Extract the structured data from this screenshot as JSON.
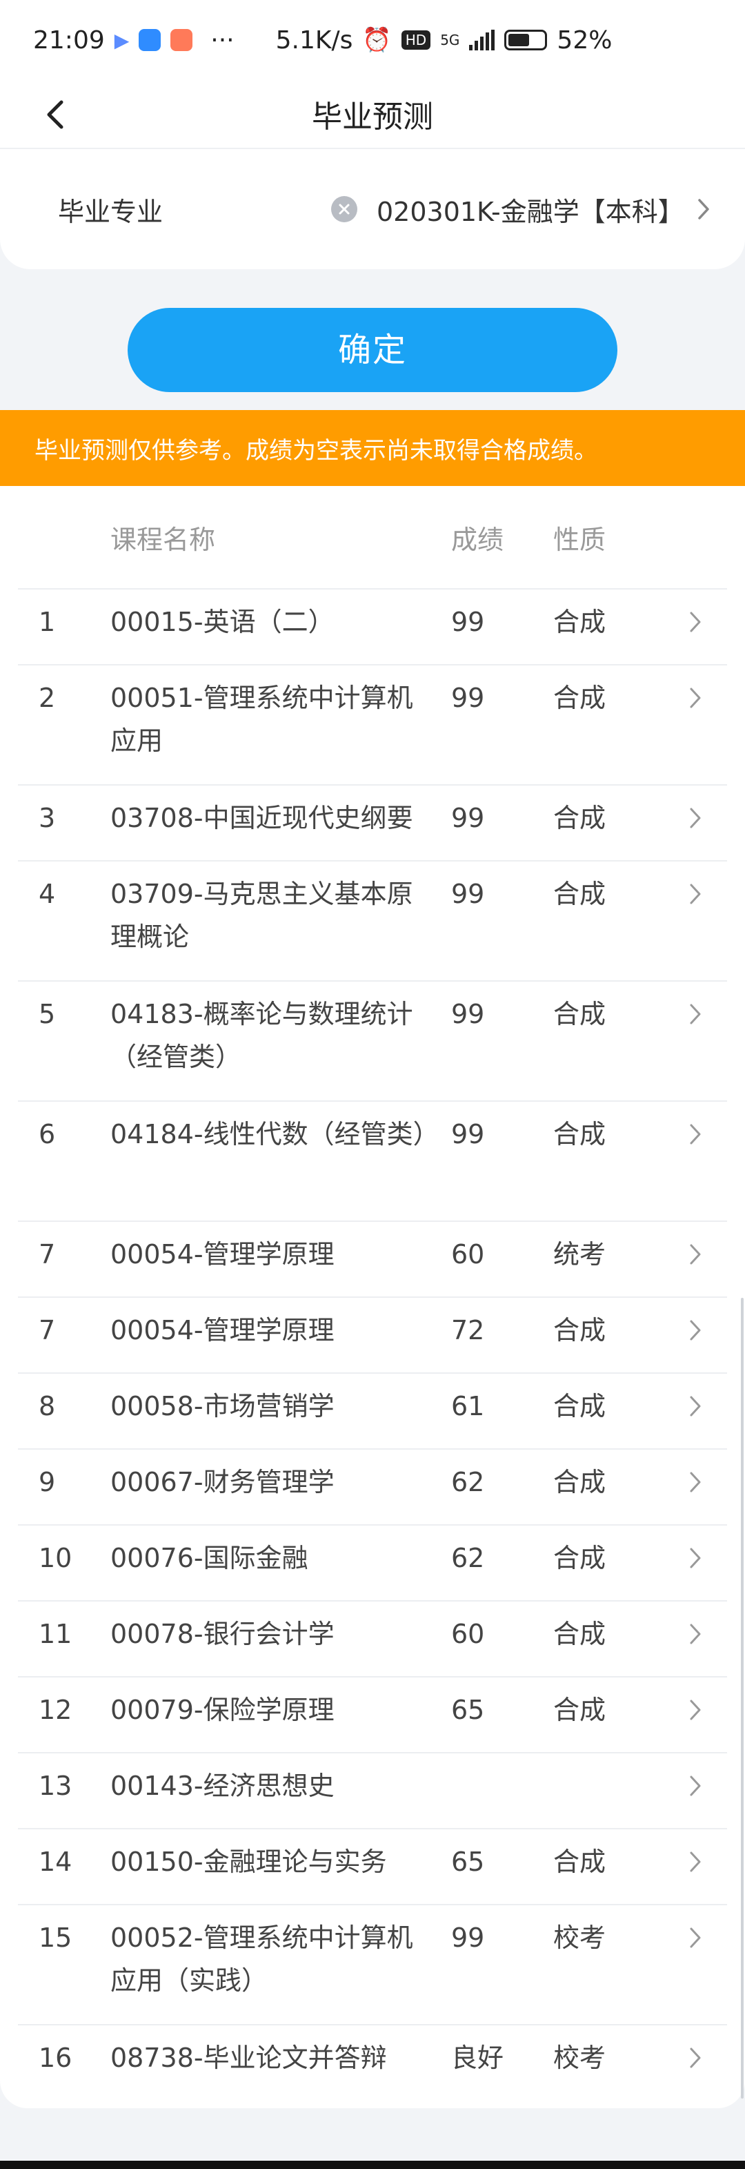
{
  "status_bar": {
    "time": "21:09",
    "dots": "···",
    "net_speed": "5.1K/s",
    "hd": "HD",
    "net_type": "5G",
    "battery": "52%"
  },
  "nav": {
    "title": "毕业预测"
  },
  "major": {
    "label": "毕业专业",
    "value": "020301K-金融学【本科】"
  },
  "confirm_label": "确定",
  "notice": "毕业预测仅供参考。成绩为空表示尚未取得合格成绩。",
  "table": {
    "headers": {
      "name": "课程名称",
      "score": "成绩",
      "type": "性质"
    },
    "rows": [
      {
        "idx": "1",
        "name": "00015-英语（二）",
        "score": "99",
        "type": "合成"
      },
      {
        "idx": "2",
        "name": "00051-管理系统中计算机应用",
        "score": "99",
        "type": "合成"
      },
      {
        "idx": "3",
        "name": "03708-中国近现代史纲要",
        "score": "99",
        "type": "合成"
      },
      {
        "idx": "4",
        "name": "03709-马克思主义基本原理概论",
        "score": "99",
        "type": "合成"
      },
      {
        "idx": "5",
        "name": "04183-概率论与数理统计（经管类）",
        "score": "99",
        "type": "合成"
      },
      {
        "idx": "6",
        "name": "04184-线性代数（经管类）",
        "score": "99",
        "type": "合成"
      },
      {
        "idx": "7",
        "name": "00054-管理学原理",
        "score": "60",
        "type": "统考"
      },
      {
        "idx": "7",
        "name": "00054-管理学原理",
        "score": "72",
        "type": "合成"
      },
      {
        "idx": "8",
        "name": "00058-市场营销学",
        "score": "61",
        "type": "合成"
      },
      {
        "idx": "9",
        "name": "00067-财务管理学",
        "score": "62",
        "type": "合成"
      },
      {
        "idx": "10",
        "name": "00076-国际金融",
        "score": "62",
        "type": "合成"
      },
      {
        "idx": "11",
        "name": "00078-银行会计学",
        "score": "60",
        "type": "合成"
      },
      {
        "idx": "12",
        "name": "00079-保险学原理",
        "score": "65",
        "type": "合成"
      },
      {
        "idx": "13",
        "name": "00143-经济思想史",
        "score": "",
        "type": ""
      },
      {
        "idx": "14",
        "name": "00150-金融理论与实务",
        "score": "65",
        "type": "合成"
      },
      {
        "idx": "15",
        "name": "00052-管理系统中计算机应用（实践）",
        "score": "99",
        "type": "校考"
      },
      {
        "idx": "16",
        "name": "08738-毕业论文并答辩",
        "score": "良好",
        "type": "校考"
      }
    ]
  },
  "colors": {
    "primary": "#1aa3f5",
    "notice_bg": "#ff9c00",
    "page_bg": "#f2f4f7"
  }
}
